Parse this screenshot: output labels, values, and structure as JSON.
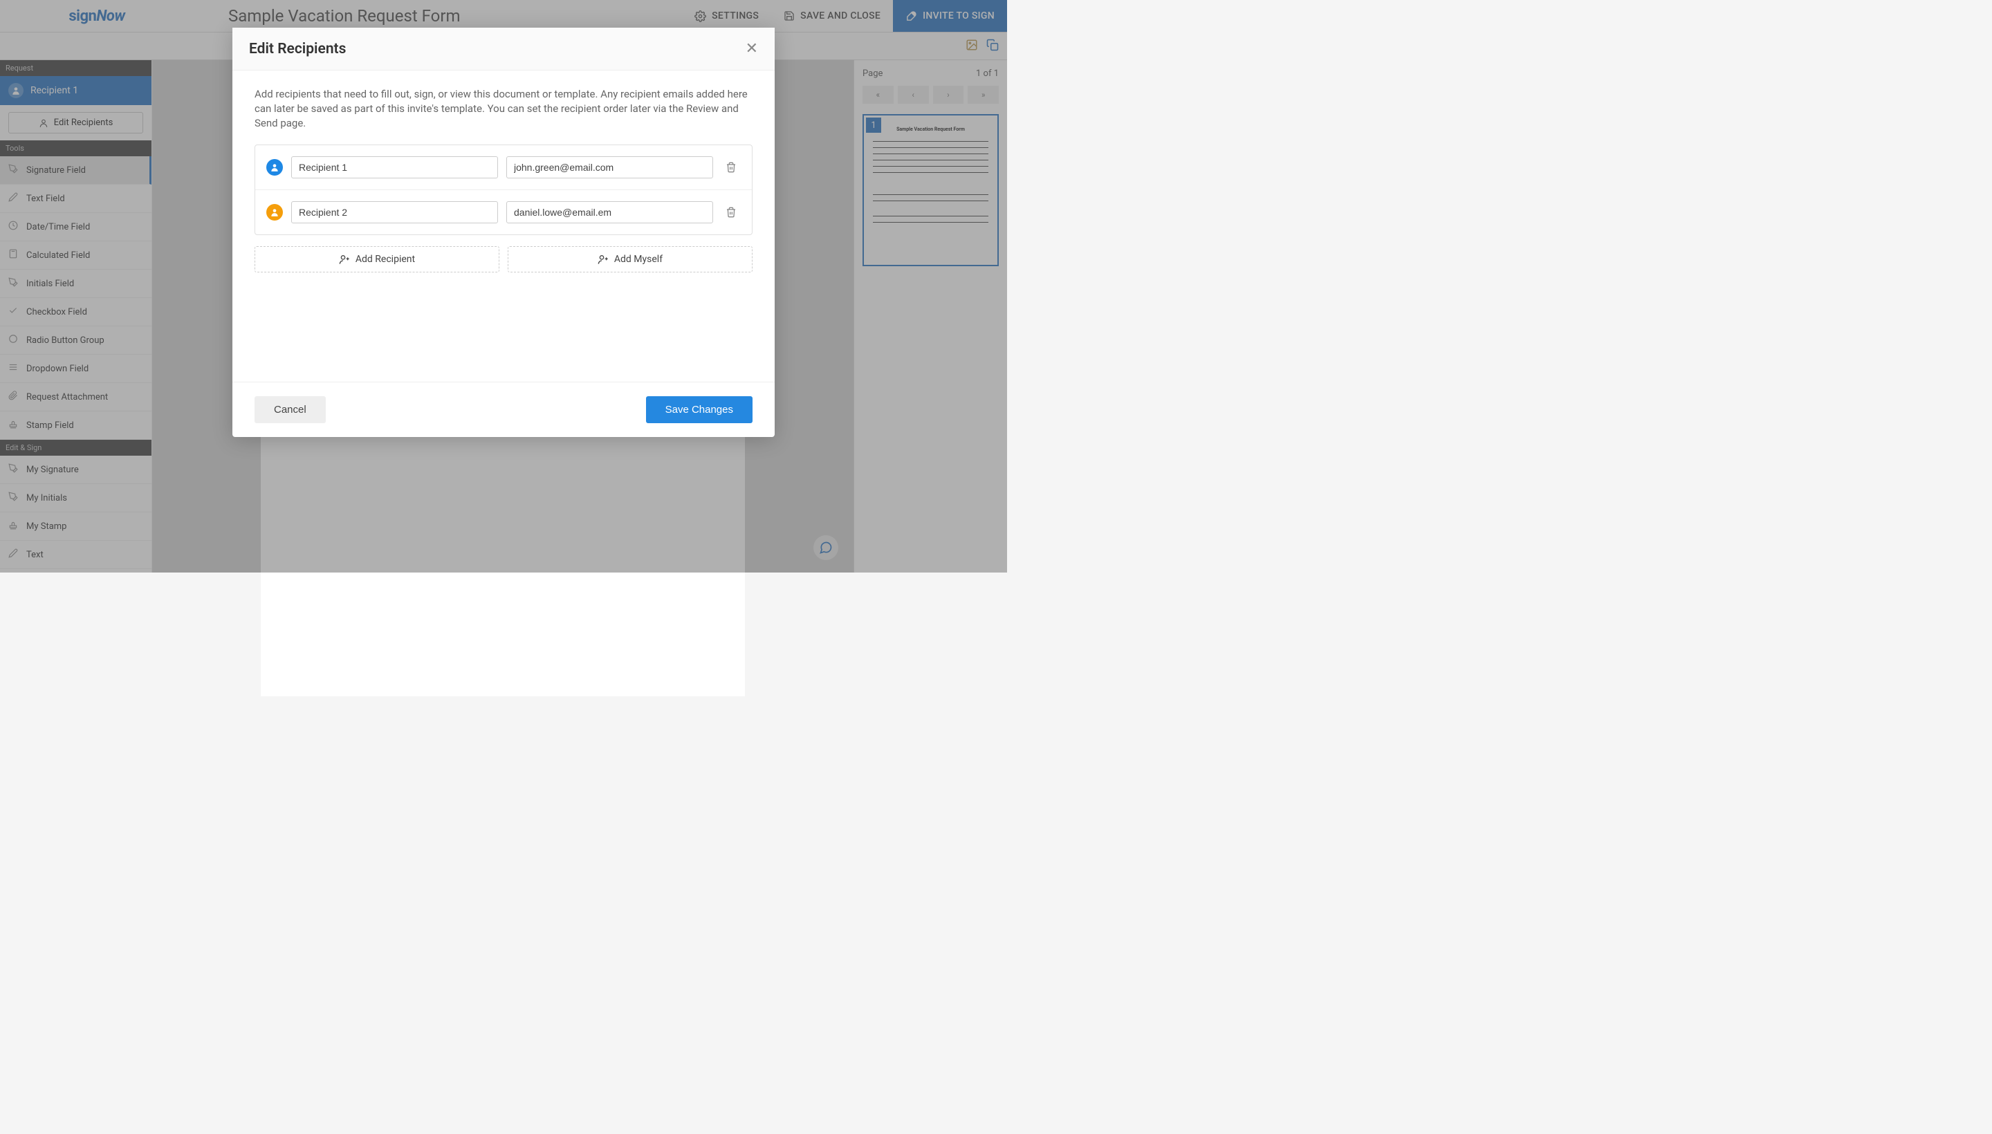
{
  "app": {
    "logo_sign": "sign",
    "logo_now": "Now",
    "document_title": "Sample Vacation Request Form",
    "settings_label": "SETTINGS",
    "save_close_label": "SAVE AND CLOSE",
    "invite_label": "INVITE TO SIGN"
  },
  "sidebar": {
    "request_header": "Request",
    "recipient_label": "Recipient 1",
    "edit_recipients_label": "Edit Recipients",
    "tools_header": "Tools",
    "tools": [
      {
        "label": "Signature Field",
        "icon": "pen-nib-icon",
        "active": true
      },
      {
        "label": "Text Field",
        "icon": "pencil-icon"
      },
      {
        "label": "Date/Time Field",
        "icon": "clock-icon"
      },
      {
        "label": "Calculated Field",
        "icon": "calculator-icon"
      },
      {
        "label": "Initials Field",
        "icon": "pen-nib-icon"
      },
      {
        "label": "Checkbox Field",
        "icon": "check-icon"
      },
      {
        "label": "Radio Button Group",
        "icon": "radio-icon"
      },
      {
        "label": "Dropdown Field",
        "icon": "list-icon"
      },
      {
        "label": "Request Attachment",
        "icon": "paperclip-icon"
      },
      {
        "label": "Stamp Field",
        "icon": "stamp-icon"
      }
    ],
    "edit_sign_header": "Edit & Sign",
    "edit_sign": [
      {
        "label": "My Signature",
        "icon": "pen-nib-icon"
      },
      {
        "label": "My Initials",
        "icon": "pen-nib-icon"
      },
      {
        "label": "My Stamp",
        "icon": "stamp-icon"
      },
      {
        "label": "Text",
        "icon": "pencil-icon"
      }
    ]
  },
  "rightpanel": {
    "page_label": "Page",
    "page_status": "1 of 1",
    "thumb_number": "1",
    "thumb_doc_title": "Sample Vacation Request Form"
  },
  "modal": {
    "title": "Edit Recipients",
    "description": "Add recipients that need to fill out, sign, or view this document or template. Any recipient emails added here can later be saved as part of this invite's template. You can set the recipient order later via the Review and Send page.",
    "recipients": [
      {
        "name": "Recipient 1",
        "email": "john.green@email.com",
        "color": "blue"
      },
      {
        "name": "Recipient 2",
        "email": "daniel.lowe@email.em",
        "color": "orange"
      }
    ],
    "add_recipient_label": "Add Recipient",
    "add_myself_label": "Add Myself",
    "cancel_label": "Cancel",
    "save_label": "Save Changes"
  }
}
